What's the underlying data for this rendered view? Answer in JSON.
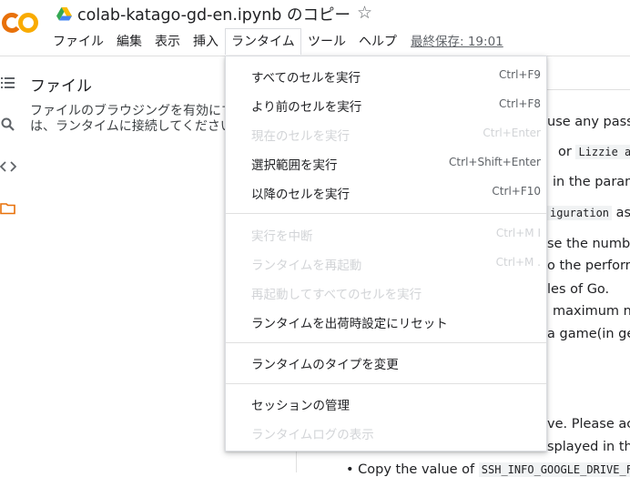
{
  "header": {
    "logo_text": "CO",
    "doc_title": "colab-katago-gd-en.ipynb のコピー",
    "last_saved": "最終保存: 19:01"
  },
  "menubar": {
    "file": "ファイル",
    "edit": "編集",
    "view": "表示",
    "insert": "挿入",
    "runtime": "ランタイム",
    "tools": "ツール",
    "help": "ヘルプ"
  },
  "panel": {
    "title": "ファイル",
    "message_line1": "ファイルのブラウジングを有効にするには",
    "message_line2": "は、ランタイムに接続してください"
  },
  "runtime_menu": {
    "items": [
      {
        "label": "すべてのセルを実行",
        "shortcut": "Ctrl+F9",
        "enabled": true
      },
      {
        "label": "より前のセルを実行",
        "shortcut": "Ctrl+F8",
        "enabled": true
      },
      {
        "label": "現在のセルを実行",
        "shortcut": "Ctrl+Enter",
        "enabled": false
      },
      {
        "label": "選択範囲を実行",
        "shortcut": "Ctrl+Shift+Enter",
        "enabled": true
      },
      {
        "label": "以降のセルを実行",
        "shortcut": "Ctrl+F10",
        "enabled": true
      },
      {
        "label": "実行を中断",
        "shortcut": "Ctrl+M I",
        "enabled": false
      },
      {
        "label": "ランタイムを再起動",
        "shortcut": "Ctrl+M .",
        "enabled": false
      },
      {
        "label": "再起動してすべてのセルを実行",
        "shortcut": "",
        "enabled": false
      },
      {
        "label": "ランタイムを出荷時設定にリセット",
        "shortcut": "",
        "enabled": true
      },
      {
        "label": "ランタイムのタイプを変更",
        "shortcut": "",
        "enabled": true
      },
      {
        "label": "セッションの管理",
        "shortcut": "",
        "enabled": true
      },
      {
        "label": "ランタイムログの表示",
        "shortcut": "",
        "enabled": false
      }
    ]
  },
  "content": {
    "line1": "use any pass",
    "line2_a": "or",
    "line2_code": "Lizzie a",
    "line3": "in the param",
    "line4_code": "iguration",
    "line4_b": "as",
    "line5": "se the numbe",
    "line6": "o the perform",
    "line7": "les of Go.",
    "line8": "maximum nu",
    "line9": "a game(in ge",
    "line10": "ve. Please ac",
    "line11": "splayed in the",
    "line12_a": "Copy the value of",
    "line12_code": "SSH_INFO_GOOGLE_DRIVE_FI"
  },
  "colors": {
    "accent_orange": "#f9ab00",
    "logo_orange_dark": "#e8710a",
    "folder_orange": "#e8710a",
    "disabled_text": "#d2d4d7"
  },
  "icons": {
    "drive": "google-drive-icon",
    "star": "star-outline-icon",
    "toc": "table-of-contents-icon",
    "search": "search-icon",
    "code": "code-snippets-icon",
    "folder": "folder-icon"
  }
}
